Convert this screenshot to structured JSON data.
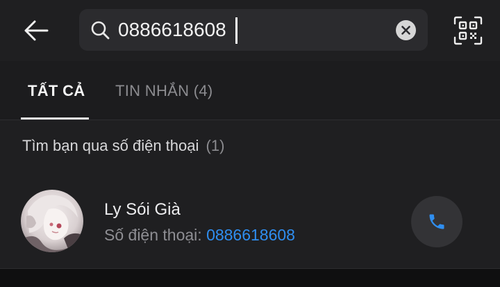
{
  "search": {
    "value": "0886618608",
    "back_icon": "arrow-left-icon",
    "search_icon": "magnifier-icon",
    "clear_icon": "close-circle-icon",
    "qr_icon": "qr-scan-icon"
  },
  "tabs": [
    {
      "label": "TẤT CẢ",
      "active": true
    },
    {
      "label": "TIN NHẮN (4)",
      "active": false
    }
  ],
  "section": {
    "title": "Tìm bạn qua số điện thoại",
    "count": "(1)"
  },
  "result": {
    "name": "Ly Sói Già",
    "phone_label": "Số điện thoại:",
    "phone_number": "0886618608",
    "call_icon": "phone-icon"
  },
  "colors": {
    "background": "#1f1f21",
    "search_field": "#2b2b2e",
    "accent_link": "#2f8ef0",
    "call_icon": "#2f8ef0",
    "call_button": "#333336"
  }
}
